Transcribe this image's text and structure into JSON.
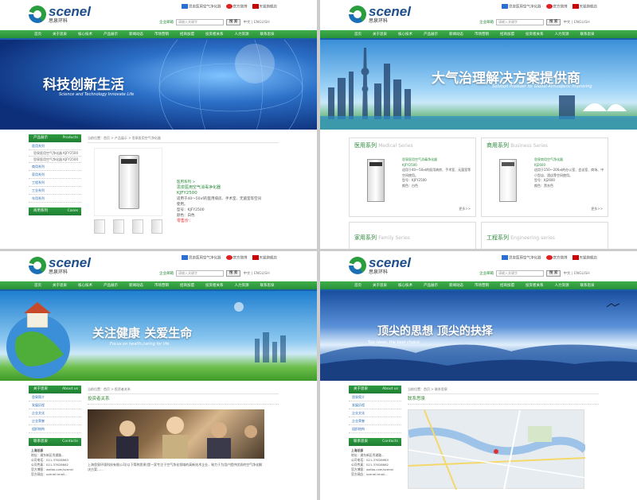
{
  "header": {
    "logo_en": "scenel",
    "logo_cn": "思泉环科",
    "toplinks": [
      "思泉医用空气净化器",
      "官方微博",
      "天猫旗舰店"
    ],
    "search_label": "企业邮箱",
    "search_placeholder": "请输入关键字",
    "search_button": "搜 索",
    "lang": "中文 | ENGLISH"
  },
  "nav": [
    "首页",
    "关于思泉",
    "核心技术",
    "产品展示",
    "新闻动态",
    "市场营销",
    "招商加盟",
    "投资者关系",
    "人力资源",
    "联系思泉"
  ],
  "panels": [
    {
      "banner_cn": "科技创新生活",
      "banner_en": "Science and Technology Innovate Life",
      "side_title": "产品展示",
      "side_title_en": "Products",
      "side_items": [
        "医用系列",
        "思泉医用空气净化器 KJFY2500",
        "思泉医用空气净化器 KJFY2500",
        "商用系列",
        "家用系列",
        "工程系列",
        "工业系列",
        "车用系列"
      ],
      "side2_title": "商用系列",
      "side2_title_en": "Cases",
      "crumb": "当前位置：首页 > 产品展示 > 思泉医用空气净化器",
      "product_series": "医用系列 >",
      "product_name": "思泉医用空气消毒净化器",
      "product_model": "KJFY2500",
      "product_desc": "适用于40～50㎡的医用病房、手术室、无菌室等空间使用。",
      "product_model_line": "型号：KJFY2500",
      "product_color_line": "颜色：白色",
      "product_price": "零售价："
    },
    {
      "banner_cn": "大气治理解决方案提供商",
      "banner_en": "Solution Provider for Global Atmosperic Improving",
      "series": [
        {
          "cn": "医用系列",
          "en": "Medical Series",
          "name": "思泉医用空气消毒净化器",
          "model": "KJFY2500",
          "desc": "适用于40～50㎡的医用病房、手术室、无菌室等空间使用。",
          "model_line": "型号：KJFY2500",
          "color_line": "颜色：白色",
          "more": "更多>>"
        },
        {
          "cn": "商用系列",
          "en": "Business Series",
          "name": "思泉商用空气净化器",
          "model": "KJ2600",
          "desc": "适用于150～200㎡的办公室、会议室、商场、中小型店、酒店等空间使用。",
          "model_line": "型号：KJ2600",
          "color_line": "颜色：黑灰色",
          "more": "更多>>"
        }
      ],
      "series_bottom": [
        {
          "cn": "家用系列",
          "en": "Family Series"
        },
        {
          "cn": "工程系列",
          "en": "Engineering series"
        }
      ]
    },
    {
      "banner_cn": "关注健康  关爱生命",
      "banner_en": "Focus on health,caring for life",
      "side_title": "关于思泉",
      "side_title_en": "About us",
      "side_items": [
        "思泉简介",
        "发展历程",
        "企业文化",
        "企业荣誉",
        "组织结构"
      ],
      "side2_title": "联系思泉",
      "side2_title_en": "Contacts",
      "contact": [
        "上海总部",
        "地址：浦东新区秀浦路...",
        "公司电话：021-37628983",
        "公司传真：021-37628662",
        "官方博客：weibo.com/scenel",
        "官方网店：scenel.tmall..."
      ],
      "crumb": "当前位置：首页 > 投资者关系",
      "section_title": "投资者关系",
      "body_text": "上海思泉环境科技有限公司(以下简称思泉)是一家专注于空气净化领域的高新技术企业，致力于为用户提供优质的空气净化解决方案……"
    },
    {
      "banner_cn": "顶尖的思想  顶尖的抉择",
      "banner_en": "Top ideas, the best choice",
      "side_title": "关于思泉",
      "side_title_en": "About us",
      "side_items": [
        "思泉简介",
        "发展历程",
        "企业文化",
        "企业荣誉",
        "组织结构"
      ],
      "side2_title": "联系思泉",
      "side2_title_en": "Contacts",
      "contact": [
        "上海总部",
        "地址：浦东新区秀浦路...",
        "公司电话：021-37628983",
        "公司传真：021-37628662",
        "官方博客：weibo.com/scenel",
        "官方网店：scenel.tmall..."
      ],
      "crumb": "当前位置：首页 > 联系思泉",
      "section_title": "联系思泉"
    }
  ]
}
